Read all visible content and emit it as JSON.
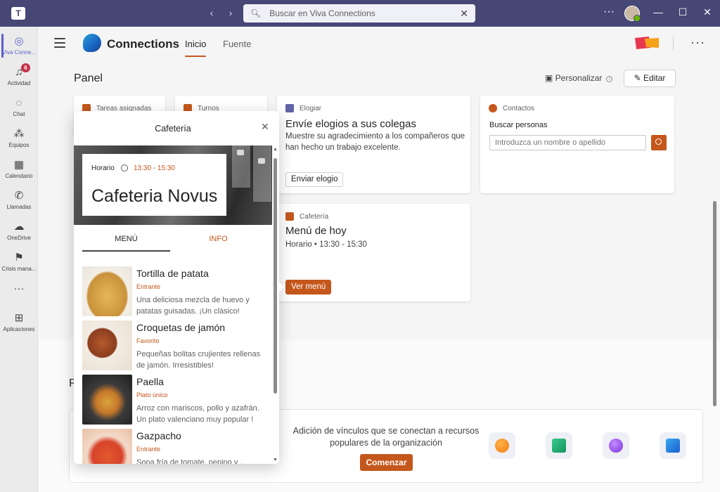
{
  "titlebar": {
    "search_placeholder": "Buscar en Viva Connections",
    "back": "‹",
    "forward": "›",
    "more": "···",
    "minimize": "—",
    "maximize": "☐",
    "close": "✕"
  },
  "rail": {
    "items": [
      {
        "label": "Viva Conne...",
        "icon": "viva-connections-icon"
      },
      {
        "label": "Actividad",
        "icon": "bell-icon",
        "badge": "6"
      },
      {
        "label": "Chat",
        "icon": "chat-icon"
      },
      {
        "label": "Equipos",
        "icon": "teams-icon"
      },
      {
        "label": "Calendario",
        "icon": "calendar-icon"
      },
      {
        "label": "Llamadas",
        "icon": "phone-icon"
      },
      {
        "label": "OneDrive",
        "icon": "cloud-icon"
      },
      {
        "label": "Crisis mana...",
        "icon": "crisis-icon"
      },
      {
        "label": "···",
        "icon": "more-icon"
      },
      {
        "label": "Aplicaciones",
        "icon": "apps-icon"
      }
    ]
  },
  "header": {
    "app_name": "Connections",
    "tabs": [
      "Inicio",
      "Fuente"
    ],
    "active_tab": "Inicio"
  },
  "dashboard": {
    "title": "Panel",
    "personalize": "Personalizar",
    "edit": "Editar",
    "cards": {
      "tasks": {
        "label": "Tareas asignadas"
      },
      "shifts": {
        "label": "Turnos"
      },
      "praise": {
        "label": "Elogiar",
        "title": "Envíe elogios a sus colegas",
        "desc": "Muestre su agradecimiento a los compañeros que han hecho un trabajo excelente.",
        "button": "Enviar elogio"
      },
      "contacts": {
        "label": "Contactos",
        "title": "Buscar personas",
        "placeholder": "Introduzca un nombre o apellido"
      },
      "cafeteria": {
        "label": "Cafetería",
        "title": "Menú de hoy",
        "hours": "Horario • 13:30 - 15:30",
        "button": "Ver menú"
      }
    }
  },
  "resources": {
    "heading_letter": "R",
    "text": "Adición de vínculos que se conectan a recursos populares de la organización",
    "button": "Comenzar"
  },
  "popup": {
    "title": "Cafetería",
    "hours_label": "Horario",
    "hours": "13:30 - 15:30",
    "name": "Cafeteria Novus",
    "tabs": [
      "MENÚ",
      "INFO"
    ],
    "items": [
      {
        "name": "Tortilla de patata",
        "category": "Entrante",
        "desc": "Una deliciosa mezcla de huevo y patatas guisadas. ¡Un clásico!"
      },
      {
        "name": "Croquetas de jamón",
        "category": "Favorito",
        "desc": "Pequeñas bolitas crujientes rellenas de jamón. Irresistibles!"
      },
      {
        "name": "Paella",
        "category": "Plato único",
        "desc": "Arroz con mariscos, pollo y azafrán. Un plato valenciano muy popular !"
      },
      {
        "name": "Gazpacho",
        "category": "Entrante",
        "desc": "Sopa fría de tomate, pepino y..."
      }
    ]
  },
  "colors": {
    "teams_purple": "#464775",
    "accent": "#c4571b",
    "active_rail": "#5b5fc7"
  }
}
